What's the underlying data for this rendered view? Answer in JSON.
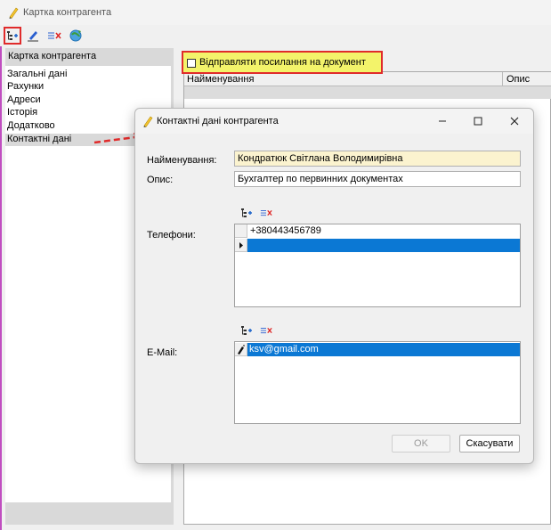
{
  "window": {
    "title": "Картка контрагента"
  },
  "toolbar": {
    "icons": [
      "tree-add-icon",
      "edit-pencil-icon",
      "delete-row-icon",
      "refresh-globe-icon"
    ]
  },
  "left_panel": {
    "header": "Картка контрагента",
    "items": [
      "Загальні дані",
      "Рахунки",
      "Адреси",
      "Історія",
      "Додатково",
      "Контактні дані"
    ],
    "selected_index": 5
  },
  "right_panel": {
    "checkbox_label": "Відправляти посилання на документ",
    "checkbox_checked": false,
    "columns": [
      "Найменування",
      "Опис"
    ]
  },
  "dialog": {
    "title": "Контактні дані контрагента",
    "name_label": "Найменування:",
    "name_value": "Кондратюк Світлана Володимирівна",
    "desc_label": "Опис:",
    "desc_value": "Бухгалтер по первинних документах",
    "phones_label": "Телефони:",
    "phones": [
      "+380443456789"
    ],
    "email_label": "E-Mail:",
    "emails": [
      "ksv@gmail.com"
    ],
    "ok_label": "OK",
    "cancel_label": "Скасувати"
  },
  "colors": {
    "accent_red": "#e02b2b",
    "highlight_yellow": "#f3f36a",
    "selection_blue": "#0b78d4"
  }
}
